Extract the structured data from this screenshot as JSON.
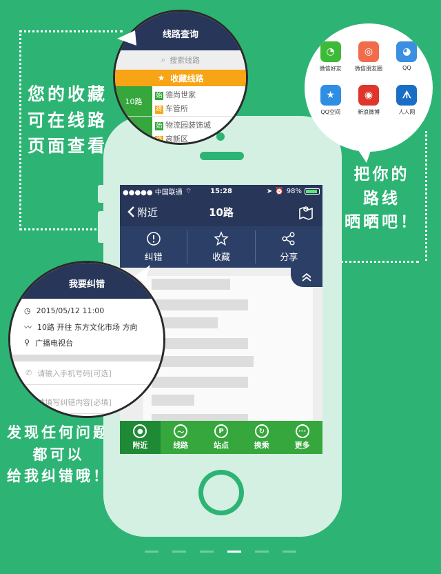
{
  "captions": {
    "left": [
      "您的收藏",
      "可在线路",
      "页面查看"
    ],
    "right": [
      "把你的",
      "路线",
      "晒晒吧！"
    ],
    "bottom": [
      "发现任何问题",
      "都可以",
      "给我纠错哦！"
    ]
  },
  "statusbar": {
    "carrier": "●●●●● 中国联通",
    "time": "15:28",
    "battery": "98%"
  },
  "navbar": {
    "back_label": "附近",
    "title": "10路"
  },
  "actions": [
    {
      "label": "纠错",
      "icon": "alert-icon"
    },
    {
      "label": "收藏",
      "icon": "star-icon"
    },
    {
      "label": "分享",
      "icon": "share-icon"
    }
  ],
  "tabs": [
    {
      "label": "附近",
      "icon": "location-pin-icon",
      "active": true
    },
    {
      "label": "线路",
      "icon": "route-icon",
      "active": false
    },
    {
      "label": "站点",
      "icon": "stop-sign-icon",
      "active": false
    },
    {
      "label": "换乘",
      "icon": "transfer-icon",
      "active": false
    },
    {
      "label": "更多",
      "icon": "more-icon",
      "active": false
    }
  ],
  "favorites_bubble": {
    "title": "线路查询",
    "search_placeholder": "搜索线路",
    "bar_label": "收藏线路",
    "routes": [
      {
        "number": "10路",
        "start": "德尚世家",
        "end": "车管所"
      },
      {
        "number": "",
        "start": "物流园装饰城",
        "end": "高新区"
      }
    ],
    "start_tag": "始",
    "end_tag": "终"
  },
  "share_bubble": {
    "items": [
      {
        "label": "微信好友",
        "icon": "wechat-icon",
        "color": "#3dba38"
      },
      {
        "label": "微信朋友圈",
        "icon": "moments-icon",
        "color": "#f06c4a"
      },
      {
        "label": "QQ",
        "icon": "qq-icon",
        "color": "#3b8fe0"
      },
      {
        "label": "QQ空间",
        "icon": "qzone-icon",
        "color": "#2d8ee3"
      },
      {
        "label": "新浪微博",
        "icon": "weibo-icon",
        "color": "#e0352b"
      },
      {
        "label": "人人网",
        "icon": "renren-icon",
        "color": "#1a6fc4"
      }
    ]
  },
  "report_bubble": {
    "title": "我要纠错",
    "time": "2015/05/12 11:00",
    "route": "10路 开往 东方文化市场 方向",
    "station": "广播电视台",
    "phone_placeholder": "请输入手机号码[可选]",
    "content_placeholder": "请填写纠错内容[必填]"
  },
  "pager": {
    "count": 6,
    "active": 3
  }
}
